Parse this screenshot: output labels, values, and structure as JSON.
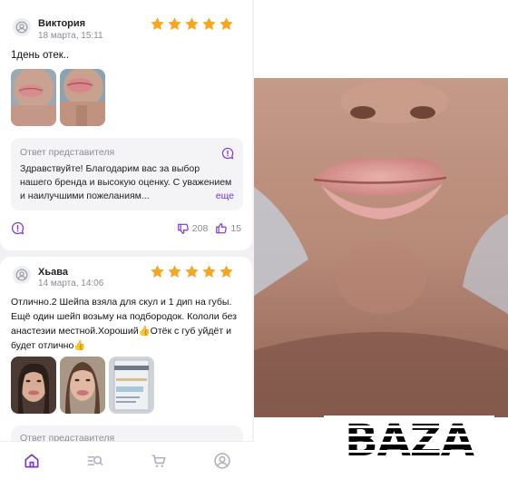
{
  "review1": {
    "author": "Виктория",
    "date": "18 марта, 15:11",
    "rating": 5,
    "text": "1день отек..",
    "reply": {
      "title": "Ответ представителя",
      "text": "Здравствуйте! Благодарим вас за выбор нашего бренда и высокую оценку. С уважением и наилучшими пожеланиям...",
      "more": "еще"
    },
    "dislikes": "208",
    "likes": "15"
  },
  "review2": {
    "author": "Хьава",
    "date": "14 марта, 14:06",
    "rating": 5,
    "text": "Отлично.2 Шейпа взяла для скул и 1 дип на губы. Ещё один шейп возьму на подбородок. Кололи без анастезии местной.Хороший👍Отёк с губ уйдёт и будет отлично👍",
    "reply_title": "Ответ представителя"
  },
  "bottom_nav": [
    "home-icon",
    "catalog-search-icon",
    "cart-icon",
    "profile-icon"
  ],
  "watermark": "BAZA",
  "colors": {
    "accent": "#7a35cf",
    "star": "#f5a623",
    "background": "#f1f1f4"
  }
}
